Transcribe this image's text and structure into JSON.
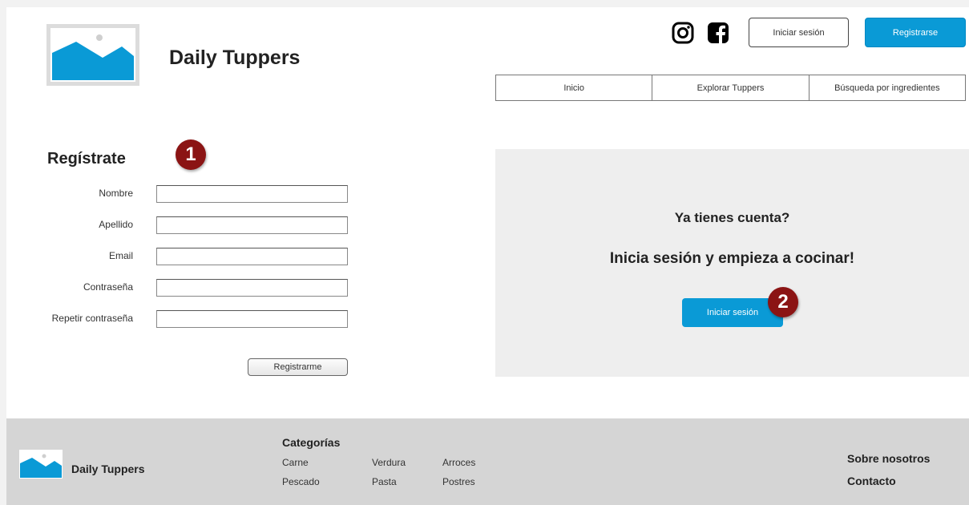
{
  "header": {
    "brand": "Daily Tuppers",
    "login_label": "Iniciar sesión",
    "register_label": "Registrarse",
    "social_icons": [
      "instagram-icon",
      "facebook-icon"
    ]
  },
  "nav": {
    "items": [
      "Inicio",
      "Explorar Tuppers",
      "Búsqueda por ingredientes"
    ]
  },
  "register": {
    "title": "Regístrate",
    "badge": "1",
    "fields": [
      {
        "label": "Nombre",
        "value": "",
        "placeholder": ""
      },
      {
        "label": "Apellido",
        "value": "",
        "placeholder": ""
      },
      {
        "label": "Email",
        "value": "",
        "placeholder": ""
      },
      {
        "label": "Contraseña",
        "value": "",
        "placeholder": ""
      },
      {
        "label": "Repetir contraseña",
        "value": "",
        "placeholder": ""
      }
    ],
    "submit_label": "Registrarme"
  },
  "login_panel": {
    "question": "Ya tienes cuenta?",
    "subtitle": "Inicia sesión y empieza a cocinar!",
    "button_label": "Iniciar sesión",
    "badge": "2"
  },
  "footer": {
    "brand": "Daily Tuppers",
    "categories_title": "Categorías",
    "categories": [
      "Carne",
      "Verdura",
      "Arroces",
      "Pescado",
      "Pasta",
      "Postres"
    ],
    "links": [
      "Sobre nosotros",
      "Contacto"
    ]
  },
  "colors": {
    "accent": "#0a9ad6",
    "badge": "#8b1414",
    "panel": "#eeeeee",
    "footer": "#d5d5d5"
  }
}
